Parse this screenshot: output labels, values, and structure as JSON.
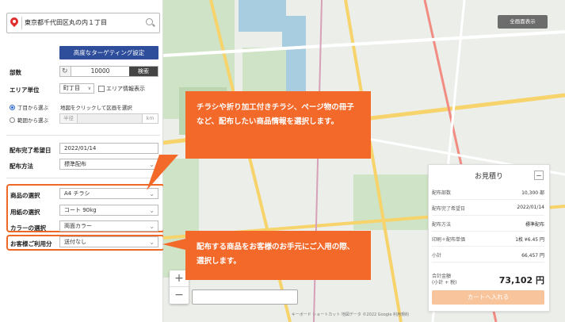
{
  "search": {
    "address": "東京都千代田区丸の内１丁目"
  },
  "panel": {
    "advanced_button": "高度なターゲティング設定",
    "count_label": "部数",
    "count_value": "10000",
    "count_button": "検索",
    "area_label": "エリア単位",
    "area_value": "町丁目",
    "area_check": "エリア情報表示",
    "radio_1": "丁目から選ぶ",
    "radio_1_hint": "地図をクリックして区画を選択",
    "radio_2": "範囲から選ぶ",
    "radius_label": "半径",
    "radius_unit": "km",
    "date_label": "配布完了希望日",
    "date_value": "2022/01/14",
    "method_label": "配布方法",
    "method_value": "標準配布",
    "product_label": "商品の選択",
    "product_value": "A4 チラシ",
    "paper_label": "用紙の選択",
    "paper_value": "コート 90kg",
    "color_label": "カラーの選択",
    "color_value": "両面カラー",
    "usage_label": "お客様ご利用分",
    "usage_value": "送付なし"
  },
  "map": {
    "fullscreen": "全画面表示",
    "zoom_in": "+",
    "zoom_out": "−",
    "attribution": "キーボード ショートカット  地図データ ©2022 Google  利用規約"
  },
  "callouts": {
    "top": "チラシや折り加工付きチラシ、ページ物の冊子など、配布したい商品情報を選択します。",
    "bottom": "配布する商品をお客様のお手元にご入用の際、選択します。"
  },
  "estimate": {
    "title": "お見積り",
    "rows": [
      {
        "label": "配布部数",
        "value": "10,300 部"
      },
      {
        "label": "配布完了希望日",
        "value": "2022/01/14"
      },
      {
        "label": "配布方法",
        "value": "標準配布"
      },
      {
        "label": "印刷＋配布単価",
        "value": "1枚 ¥6.45 円"
      },
      {
        "label": "小計",
        "value": "66,457 円"
      }
    ],
    "total_label": "合計金額\n(小計 + 税)",
    "total_value": "73,102 円",
    "cart_button": "カートへ入れる"
  },
  "colors": {
    "accent": "#f2692a",
    "brand": "#2e4d9b"
  }
}
